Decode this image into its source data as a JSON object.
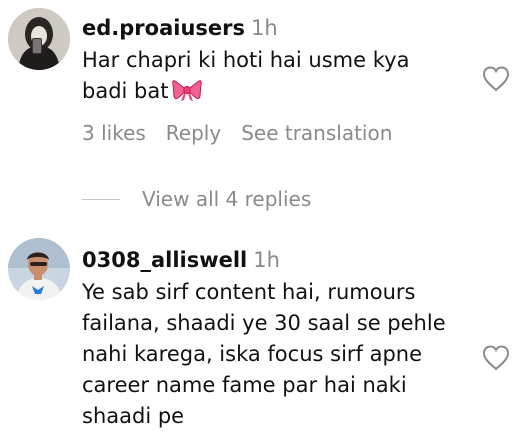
{
  "comments": [
    {
      "username": "ed.proaiusers",
      "time": "1h",
      "lines": [
        "Har chapri ki hoti hai usme kya",
        "badi bat"
      ],
      "emoji": "pink-bow",
      "likes": "3 likes",
      "reply": "Reply",
      "see_translation": "See translation"
    },
    {
      "username": "0308_alliswell",
      "time": "1h",
      "lines": [
        "Ye sab sirf content hai, rumours",
        "failana, shaadi ye 30 saal se pehle",
        "nahi karega, iska focus sirf apne",
        "career name fame par hai naki",
        "shaadi pe"
      ]
    }
  ],
  "view_replies": "View all 4 replies",
  "icons": {
    "heart": "heart-outline-icon",
    "bow": "pink-bow-emoji"
  },
  "colors": {
    "text": "#111111",
    "muted": "#8a8a8a",
    "bow": "#f06292"
  }
}
